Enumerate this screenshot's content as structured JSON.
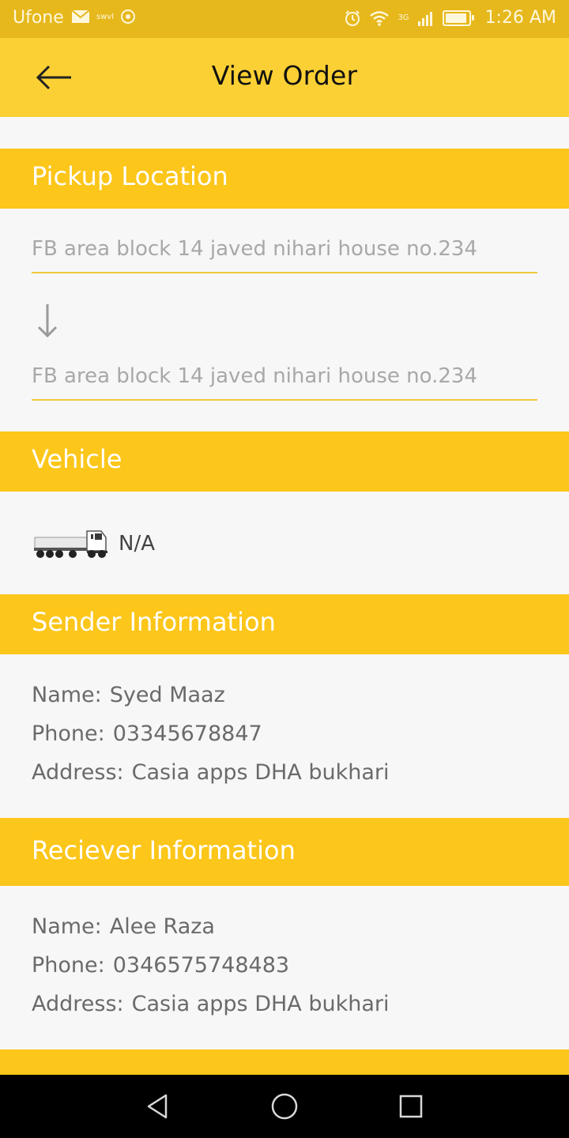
{
  "status_bar": {
    "carrier": "Ufone",
    "mini_label": "swvl",
    "network": "3G",
    "time": "1:26 AM",
    "icons": [
      "mail-icon",
      "swvl-icon",
      "imo-icon",
      "alarm-icon",
      "wifi-icon",
      "signal-icon",
      "battery-icon"
    ]
  },
  "app_bar": {
    "title": "View Order",
    "back_icon": "arrow-left-icon"
  },
  "pickup": {
    "header": "Pickup Location",
    "from": "FB area block 14 javed nihari house no.234",
    "to": "FB area block 14 javed nihari house no.234"
  },
  "vehicle": {
    "header": "Vehicle",
    "name": "N/A",
    "icon": "truck-icon"
  },
  "sender": {
    "header": "Sender Information",
    "name_label": "Name:",
    "name": "Syed Maaz",
    "phone_label": "Phone:",
    "phone": "03345678847",
    "address_label": "Address:",
    "address": "Casia apps DHA bukhari"
  },
  "receiver": {
    "header": "Reciever Information",
    "name_label": "Name:",
    "name": "Alee Raza",
    "phone_label": "Phone:",
    "phone": "0346575748483",
    "address_label": "Address:",
    "address": "Casia apps DHA bukhari"
  },
  "colors": {
    "status_bar": "#e6b81c",
    "app_bar": "#fbd034",
    "section_header": "#fcc61a",
    "background": "#f7f7f7"
  },
  "nav": {
    "icons": [
      "back-triangle-icon",
      "home-circle-icon",
      "recents-square-icon"
    ]
  }
}
